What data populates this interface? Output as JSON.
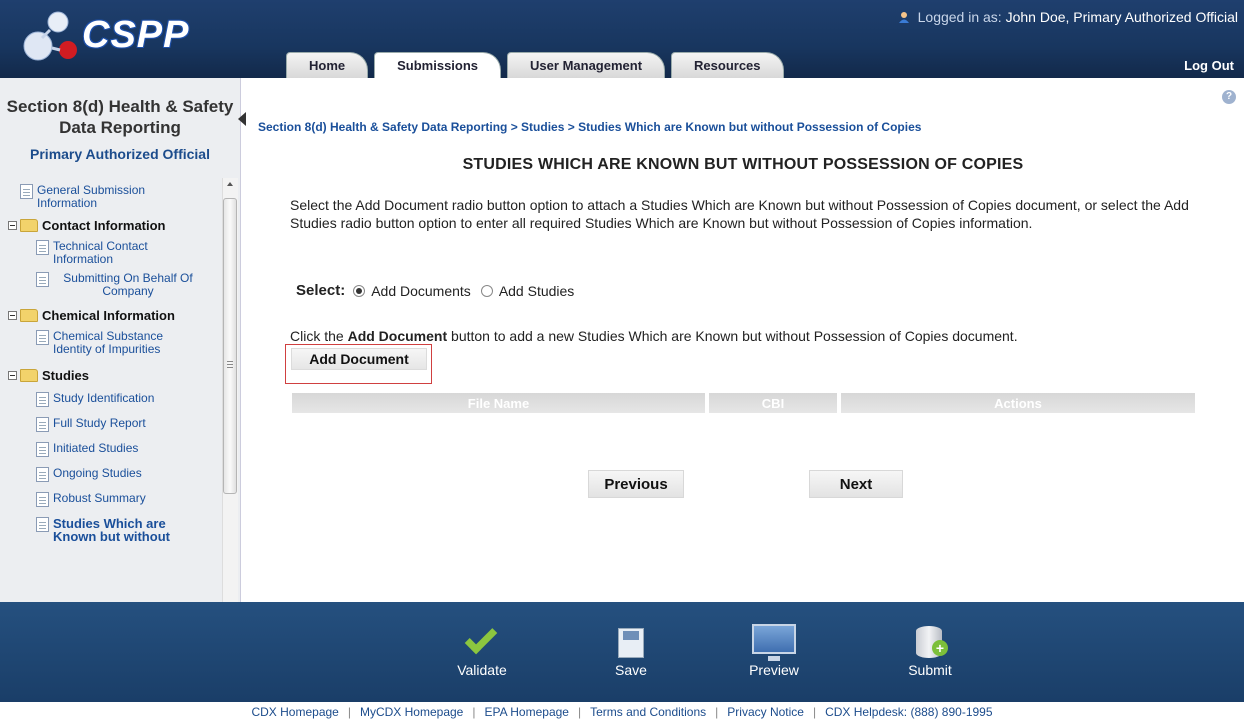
{
  "header": {
    "logo_text": "CSPP",
    "logged_in_prefix": "Logged in as:",
    "logged_in_user": "John Doe, Primary Authorized Official",
    "tabs": [
      {
        "label": "Home"
      },
      {
        "label": "Submissions"
      },
      {
        "label": "User Management"
      },
      {
        "label": "Resources"
      }
    ],
    "logout": "Log Out"
  },
  "sidebar": {
    "title": "Section 8(d) Health & Safety Data Reporting",
    "role": "Primary Authorized Official",
    "general_submission": "General Submission Information",
    "contact": {
      "label": "Contact Information",
      "items": [
        "Technical Contact Information",
        "Submitting On Behalf Of Company"
      ]
    },
    "chemical": {
      "label": "Chemical Information",
      "items": [
        "Chemical Substance Identity of Impurities"
      ]
    },
    "studies": {
      "label": "Studies",
      "items": [
        "Study Identification",
        "Full Study Report",
        "Initiated Studies",
        "Ongoing Studies",
        "Robust Summary",
        "Studies Which are Known but without"
      ]
    }
  },
  "main": {
    "breadcrumb": "Section 8(d) Health & Safety Data Reporting > Studies > Studies Which are Known but without Possession of Copies",
    "title": "STUDIES WHICH ARE KNOWN BUT WITHOUT POSSESSION OF COPIES",
    "instructions": "Select the Add Document radio button option to attach a Studies Which are Known but without Possession of Copies document, or select the Add Studies radio button option to enter all required Studies Which are Known but without Possession of Copies information.",
    "select_label": "Select:",
    "radio_documents": "Add Documents",
    "radio_studies": "Add Studies",
    "click_prefix": "Click the ",
    "click_bold": "Add Document",
    "click_suffix": " button to add a new Studies Which are Known but without Possession of Copies document.",
    "add_document_button": "Add Document",
    "table_headers": {
      "file_name": "File Name",
      "cbi": "CBI",
      "actions": "Actions"
    },
    "previous": "Previous",
    "next": "Next"
  },
  "toolbar": {
    "validate": "Validate",
    "save": "Save",
    "preview": "Preview",
    "submit": "Submit"
  },
  "footer": {
    "links": [
      "CDX Homepage",
      "MyCDX Homepage",
      "EPA Homepage",
      "Terms and Conditions",
      "Privacy Notice",
      "CDX Helpdesk: (888) 890-1995"
    ]
  },
  "colors": {
    "header_bg": "#1f3f6e",
    "link_blue": "#1a4f9a",
    "highlight_red": "#d04040",
    "validate_green": "#8cc63f"
  }
}
